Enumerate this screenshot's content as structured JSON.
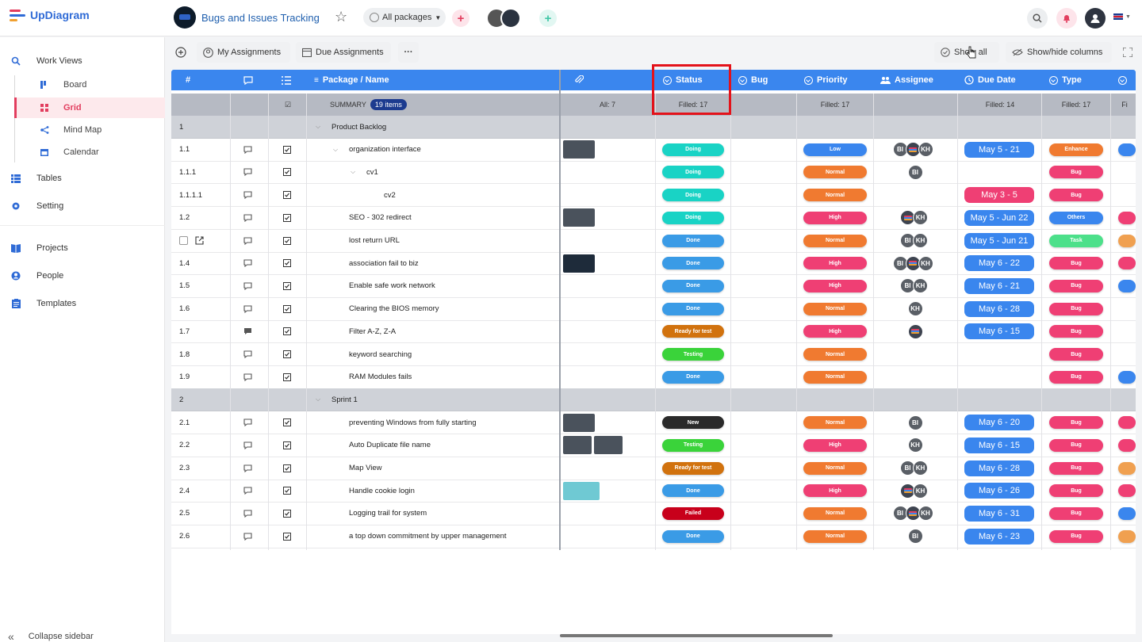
{
  "app": {
    "logo": "UpDiagram",
    "workspace_title": "Bugs and Issues Tracking",
    "package_select": "All packages"
  },
  "sidebar": {
    "work_views": "Work Views",
    "views": [
      {
        "label": "Board",
        "icon": "board-icon"
      },
      {
        "label": "Grid",
        "icon": "grid-icon"
      },
      {
        "label": "Mind Map",
        "icon": "mindmap-icon"
      },
      {
        "label": "Calendar",
        "icon": "calendar-icon"
      }
    ],
    "tables": "Tables",
    "setting": "Setting",
    "projects": "Projects",
    "people": "People",
    "templates": "Templates",
    "collapse": "Collapse sidebar"
  },
  "toolbar": {
    "my_assignments": "My Assignments",
    "due_assignments": "Due Assignments",
    "more": "···",
    "show_all": "Show all",
    "show_hide": "Show/hide columns"
  },
  "columns": {
    "num": "#",
    "package_name": "Package / Name",
    "status": "Status",
    "bug": "Bug",
    "priority": "Priority",
    "assignee": "Assignee",
    "due_date": "Due Date",
    "type": "Type"
  },
  "summary": {
    "label": "SUMMARY",
    "count": "19 items",
    "attach": "All: 7",
    "status": "Filled: 17",
    "priority": "Filled: 17",
    "due": "Filled: 14",
    "type": "Filled: 17",
    "extra": "Fi"
  },
  "colors": {
    "accent": "#3a86ee",
    "brand_red": "#e23d5e",
    "doing": "#19d3c5",
    "done": "#3a9be6",
    "ready": "#d1720e",
    "testing": "#3ad33a",
    "new": "#2a2a2a",
    "failed": "#c8001b",
    "low": "#3a86ee",
    "normal": "#f07a30",
    "high": "#ef3f74",
    "enhance": "#f07a30",
    "bug": "#ef3f74",
    "others": "#3a86ee",
    "task": "#4ce08a"
  },
  "rows": [
    {
      "id": "1",
      "group": true,
      "name": "Product Backlog"
    },
    {
      "id": "1.1",
      "name": "organization interface",
      "indent": 1,
      "chev": true,
      "thumbs": 1,
      "status": "Doing",
      "status_color": "#19d3c5",
      "priority": "Low",
      "priority_color": "#3a86ee",
      "assignees": [
        "BI",
        "img",
        "KH"
      ],
      "due": "May 5 - 21",
      "type": "Enhance",
      "type_color": "#f07a30",
      "extra": "#3a86ee"
    },
    {
      "id": "1.1.1",
      "name": "cv1",
      "indent": 2,
      "chev": true,
      "thumbs": 0,
      "status": "Doing",
      "status_color": "#19d3c5",
      "priority": "Normal",
      "priority_color": "#f07a30",
      "assignees": [
        "BI"
      ],
      "due": "",
      "type": "Bug",
      "type_color": "#ef3f74",
      "extra": ""
    },
    {
      "id": "1.1.1.1",
      "name": "cv2",
      "indent": 3,
      "thumbs": 0,
      "status": "Doing",
      "status_color": "#19d3c5",
      "priority": "Normal",
      "priority_color": "#f07a30",
      "assignees": [],
      "due": "May 3 - 5",
      "due_color": "#ef3f74",
      "type": "Bug",
      "type_color": "#ef3f74",
      "extra": ""
    },
    {
      "id": "1.2",
      "name": "SEO - 302 redirect",
      "indent": 1,
      "thumbs": 1,
      "status": "Doing",
      "status_color": "#19d3c5",
      "priority": "High",
      "priority_color": "#ef3f74",
      "assignees": [
        "img",
        "KH"
      ],
      "due": "May 5 - Jun 22",
      "type": "Others",
      "type_color": "#3a86ee",
      "extra": "#ef3f74"
    },
    {
      "id": "",
      "name": "lost return URL",
      "indent": 1,
      "thumbs": 0,
      "status": "Done",
      "status_color": "#3a9be6",
      "priority": "Normal",
      "priority_color": "#f07a30",
      "assignees": [
        "BI",
        "KH"
      ],
      "due": "May 5 - Jun 21",
      "type": "Task",
      "type_color": "#4ce08a",
      "extra": "#f0a050",
      "hover": true
    },
    {
      "id": "1.4",
      "name": "association fail to biz",
      "indent": 1,
      "thumbs": 1,
      "status": "Done",
      "status_color": "#3a9be6",
      "priority": "High",
      "priority_color": "#ef3f74",
      "assignees": [
        "BI",
        "img",
        "KH"
      ],
      "due": "May 6 - 22",
      "type": "Bug",
      "type_color": "#ef3f74",
      "extra": "#ef3f74"
    },
    {
      "id": "1.5",
      "name": "Enable safe work network",
      "indent": 1,
      "thumbs": 0,
      "status": "Done",
      "status_color": "#3a9be6",
      "priority": "High",
      "priority_color": "#ef3f74",
      "assignees": [
        "BI",
        "KH"
      ],
      "due": "May 6 - 21",
      "type": "Bug",
      "type_color": "#ef3f74",
      "extra": "#3a86ee"
    },
    {
      "id": "1.6",
      "name": "Clearing the BIOS memory",
      "indent": 1,
      "thumbs": 0,
      "status": "Done",
      "status_color": "#3a9be6",
      "priority": "Normal",
      "priority_color": "#f07a30",
      "assignees": [
        "KH"
      ],
      "due": "May 6 - 28",
      "type": "Bug",
      "type_color": "#ef3f74",
      "extra": ""
    },
    {
      "id": "1.7",
      "name": "Filter A-Z, Z-A",
      "indent": 1,
      "thumbs": 0,
      "status": "Ready for test",
      "status_color": "#d1720e",
      "priority": "High",
      "priority_color": "#ef3f74",
      "assignees": [
        "img"
      ],
      "due": "May 6 - 15",
      "type": "Bug",
      "type_color": "#ef3f74",
      "extra": "",
      "comment": true
    },
    {
      "id": "1.8",
      "name": "keyword searching",
      "indent": 1,
      "thumbs": 0,
      "status": "Testing",
      "status_color": "#3ad33a",
      "priority": "Normal",
      "priority_color": "#f07a30",
      "assignees": [],
      "due": "",
      "type": "Bug",
      "type_color": "#ef3f74",
      "extra": ""
    },
    {
      "id": "1.9",
      "name": "RAM Modules fails",
      "indent": 1,
      "thumbs": 0,
      "status": "Done",
      "status_color": "#3a9be6",
      "priority": "Normal",
      "priority_color": "#f07a30",
      "assignees": [],
      "due": "",
      "type": "Bug",
      "type_color": "#ef3f74",
      "extra": "#3a86ee"
    },
    {
      "id": "2",
      "group": true,
      "name": "Sprint 1"
    },
    {
      "id": "2.1",
      "name": "preventing Windows from fully starting",
      "indent": 1,
      "thumbs": 1,
      "status": "New",
      "status_color": "#2a2a2a",
      "priority": "Normal",
      "priority_color": "#f07a30",
      "assignees": [
        "BI"
      ],
      "due": "May 6 - 20",
      "type": "Bug",
      "type_color": "#ef3f74",
      "extra": "#ef3f74"
    },
    {
      "id": "2.2",
      "name": "Auto Duplicate file name",
      "indent": 1,
      "thumbs": 2,
      "status": "Testing",
      "status_color": "#3ad33a",
      "priority": "High",
      "priority_color": "#ef3f74",
      "assignees": [
        "KH"
      ],
      "due": "May 6 - 15",
      "type": "Bug",
      "type_color": "#ef3f74",
      "extra": "#ef3f74"
    },
    {
      "id": "2.3",
      "name": "Map View",
      "indent": 1,
      "thumbs": 0,
      "status": "Ready for test",
      "status_color": "#d1720e",
      "priority": "Normal",
      "priority_color": "#f07a30",
      "assignees": [
        "BI",
        "KH"
      ],
      "due": "May 6 - 28",
      "type": "Bug",
      "type_color": "#ef3f74",
      "extra": "#f0a050"
    },
    {
      "id": "2.4",
      "name": "Handle cookie login",
      "indent": 1,
      "thumbs": 1,
      "thumb_light": true,
      "status": "Done",
      "status_color": "#3a9be6",
      "priority": "High",
      "priority_color": "#ef3f74",
      "assignees": [
        "img",
        "KH"
      ],
      "due": "May 6 - 26",
      "type": "Bug",
      "type_color": "#ef3f74",
      "extra": "#ef3f74"
    },
    {
      "id": "2.5",
      "name": "Logging trail for system",
      "indent": 1,
      "thumbs": 0,
      "status": "Failed",
      "status_color": "#c8001b",
      "priority": "Normal",
      "priority_color": "#f07a30",
      "assignees": [
        "BI",
        "img",
        "KH"
      ],
      "due": "May 6 - 31",
      "type": "Bug",
      "type_color": "#ef3f74",
      "extra": "#3a86ee"
    },
    {
      "id": "2.6",
      "name": "a top down commitment by upper management",
      "indent": 1,
      "thumbs": 0,
      "status": "Done",
      "status_color": "#3a9be6",
      "priority": "Normal",
      "priority_color": "#f07a30",
      "assignees": [
        "BI"
      ],
      "due": "May 6 - 23",
      "type": "Bug",
      "type_color": "#ef3f74",
      "extra": "#f0a050"
    }
  ]
}
